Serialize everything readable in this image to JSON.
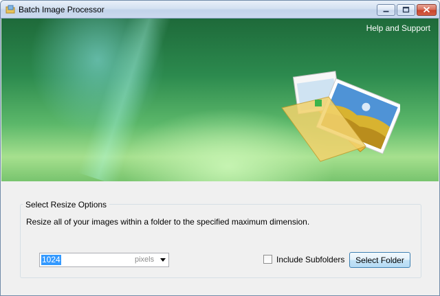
{
  "window": {
    "title": "Batch Image Processor"
  },
  "titlebar": {
    "icons": [
      "app-icon",
      "minimize-icon",
      "maximize-icon",
      "close-icon"
    ]
  },
  "banner": {
    "help_link": "Help and Support",
    "art": "folder-with-images-icon"
  },
  "resize_options": {
    "group_label": "Select Resize Options",
    "description": "Resize all of your images within a folder to the specified maximum dimension.",
    "size_value": "1024",
    "size_unit": "pixels",
    "include_subfolders_label": "Include Subfolders",
    "include_subfolders_checked": false,
    "select_folder_label": "Select Folder"
  },
  "colors": {
    "banner_green": "#2c8a4e",
    "selection": "#3399ff",
    "close_red": "#c7442c"
  }
}
